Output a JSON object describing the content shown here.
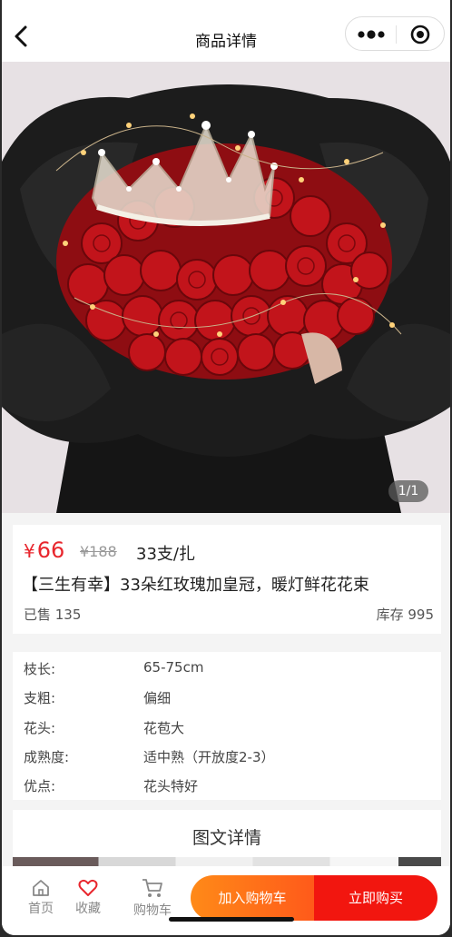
{
  "header": {
    "title": "商品详情"
  },
  "gallery": {
    "counter": "1/1"
  },
  "product": {
    "price_symbol": "¥",
    "price": "66",
    "original_price": "¥188",
    "unit": "33支/扎",
    "name": "【三生有幸】33朵红玫瑰加皇冠，暖灯鲜花花束",
    "sold": "已售 135",
    "stock": "库存 995"
  },
  "specs": [
    {
      "key": "枝长:",
      "value": "65-75cm"
    },
    {
      "key": "支粗:",
      "value": "偏细"
    },
    {
      "key": "花头:",
      "value": "花苞大"
    },
    {
      "key": "成熟度:",
      "value": "适中熟（开放度2-3）"
    },
    {
      "key": "优点:",
      "value": "花头特好"
    }
  ],
  "detail": {
    "title": "图文详情"
  },
  "bottom_bar": {
    "home_label": "首页",
    "favorite_label": "收藏",
    "cart_label": "购物车",
    "add_to_cart_label": "加入购物车",
    "buy_now_label": "立即购买"
  },
  "colors": {
    "price": "#e8262d",
    "cart_button": "#ff6a1a",
    "buy_button": "#f2160f"
  }
}
